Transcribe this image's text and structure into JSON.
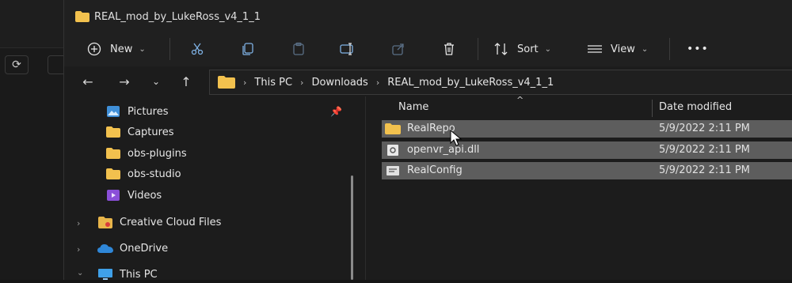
{
  "window": {
    "title": "REAL_mod_by_LukeRoss_v4_1_1"
  },
  "toolbar": {
    "new_label": "New",
    "sort_label": "Sort",
    "view_label": "View",
    "more_label": "•••"
  },
  "address": {
    "crumbs": [
      "This PC",
      "Downloads",
      "REAL_mod_by_LukeRoss_v4_1_1"
    ]
  },
  "nav_pane": {
    "items": [
      {
        "label": "Pictures",
        "icon": "pictures-icon"
      },
      {
        "label": "Captures",
        "icon": "folder-icon"
      },
      {
        "label": "obs-plugins",
        "icon": "folder-icon"
      },
      {
        "label": "obs-studio",
        "icon": "folder-icon"
      },
      {
        "label": "Videos",
        "icon": "videos-icon"
      },
      {
        "label": "Creative Cloud Files",
        "icon": "creative-cloud-icon"
      },
      {
        "label": "OneDrive",
        "icon": "onedrive-icon"
      },
      {
        "label": "This PC",
        "icon": "this-pc-icon"
      }
    ]
  },
  "file_list": {
    "columns": {
      "name": "Name",
      "date_modified": "Date modified"
    },
    "rows": [
      {
        "name": "RealRepo",
        "date": "5/9/2022 2:11 PM",
        "icon": "folder-icon"
      },
      {
        "name": "openvr_api.dll",
        "date": "5/9/2022 2:11 PM",
        "icon": "dll-file-icon"
      },
      {
        "name": "RealConfig",
        "date": "5/9/2022 2:11 PM",
        "icon": "config-file-icon"
      }
    ]
  },
  "colors": {
    "folder": "#f2c14e",
    "selection": "#5d5d5d",
    "background": "#1c1c1c"
  }
}
